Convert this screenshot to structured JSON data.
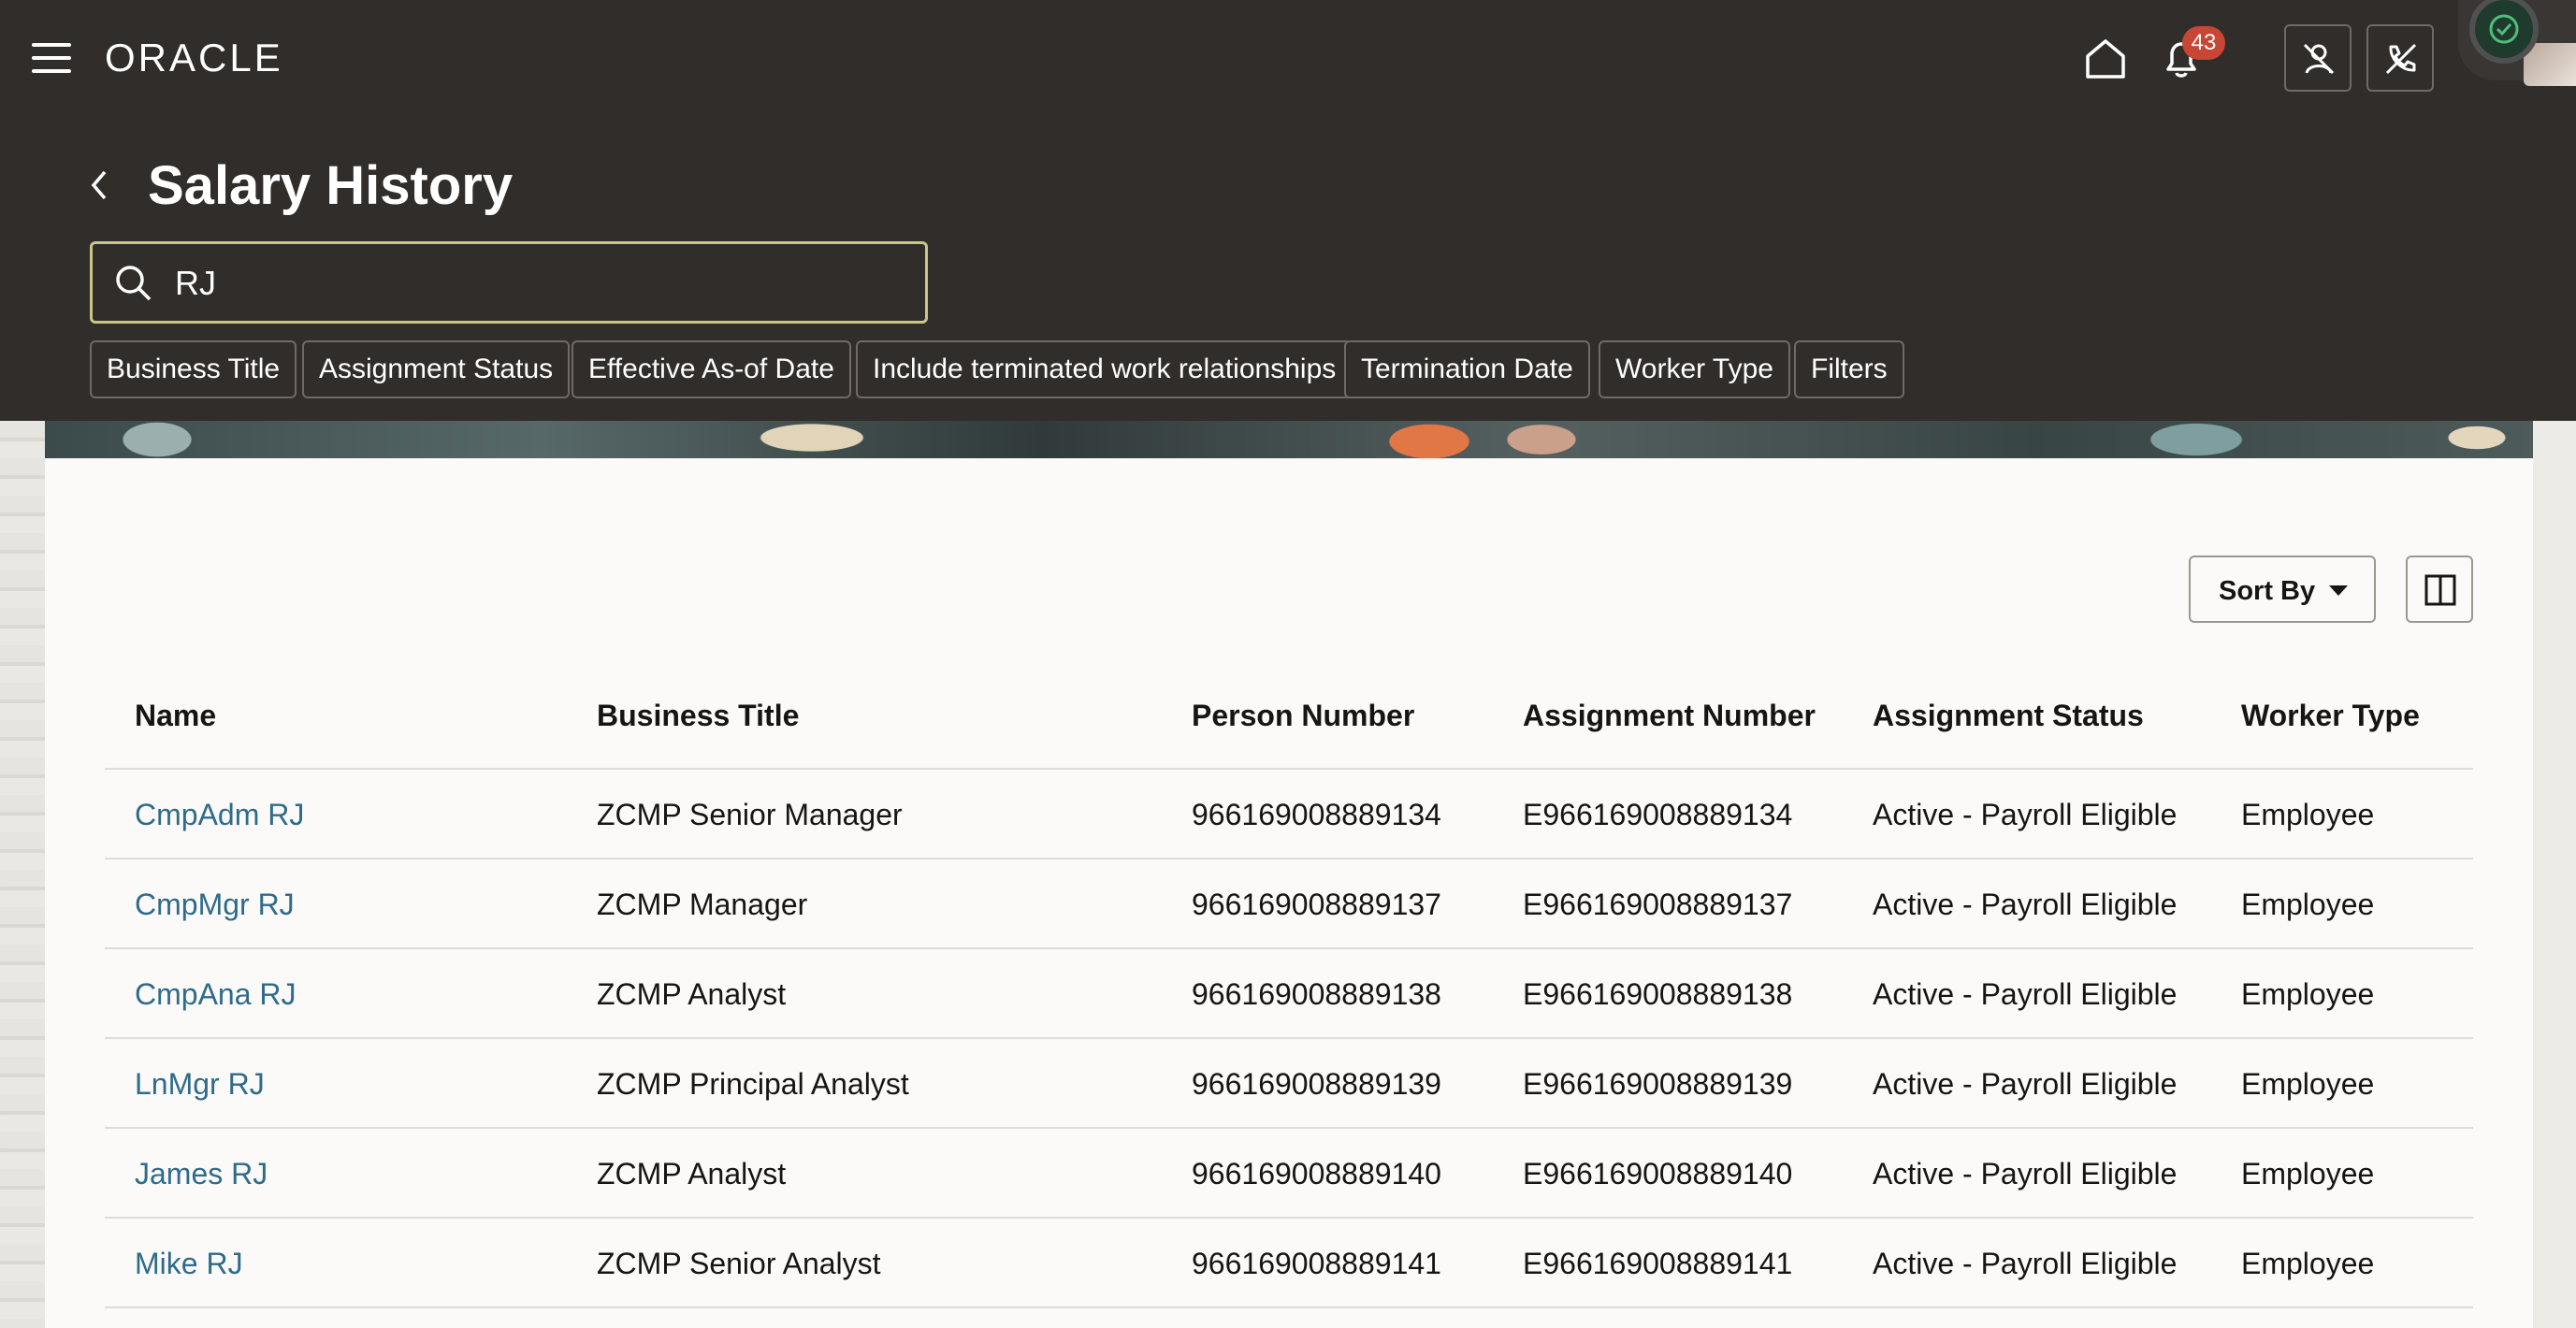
{
  "app": {
    "logo": "ORACLE",
    "notification_count": "43"
  },
  "page": {
    "title": "Salary History"
  },
  "search": {
    "value": "RJ"
  },
  "filter_chips": [
    "Business Title",
    "Assignment Status",
    "Effective As-of Date",
    "Include terminated work relationships",
    "Termination Date",
    "Worker Type",
    "Filters"
  ],
  "toolbar": {
    "sort_label": "Sort By"
  },
  "table": {
    "columns": [
      "Name",
      "Business Title",
      "Person Number",
      "Assignment Number",
      "Assignment Status",
      "Worker Type"
    ],
    "rows": [
      [
        "CmpAdm RJ",
        "ZCMP Senior Manager",
        "966169008889134",
        "E966169008889134",
        "Active - Payroll Eligible",
        "Employee"
      ],
      [
        "CmpMgr RJ",
        "ZCMP Manager",
        "966169008889137",
        "E966169008889137",
        "Active - Payroll Eligible",
        "Employee"
      ],
      [
        "CmpAna RJ",
        "ZCMP Analyst",
        "966169008889138",
        "E966169008889138",
        "Active - Payroll Eligible",
        "Employee"
      ],
      [
        "LnMgr RJ",
        "ZCMP Principal Analyst",
        "966169008889139",
        "E966169008889139",
        "Active - Payroll Eligible",
        "Employee"
      ],
      [
        "James RJ",
        "ZCMP Analyst",
        "966169008889140",
        "E966169008889140",
        "Active - Payroll Eligible",
        "Employee"
      ],
      [
        "Mike RJ",
        "ZCMP Senior Analyst",
        "966169008889141",
        "E966169008889141",
        "Active - Payroll Eligible",
        "Employee"
      ]
    ]
  },
  "colors": {
    "header_bg": "#312d2a",
    "link": "#2f6b8a",
    "badge": "#c74634",
    "search_border": "#c7c888"
  },
  "icons": [
    "menu-icon",
    "home-icon",
    "bell-icon",
    "person-off-icon",
    "phone-off-icon",
    "check-circle-icon",
    "back-icon",
    "search-icon",
    "caret-down-icon",
    "panel-layout-icon"
  ]
}
